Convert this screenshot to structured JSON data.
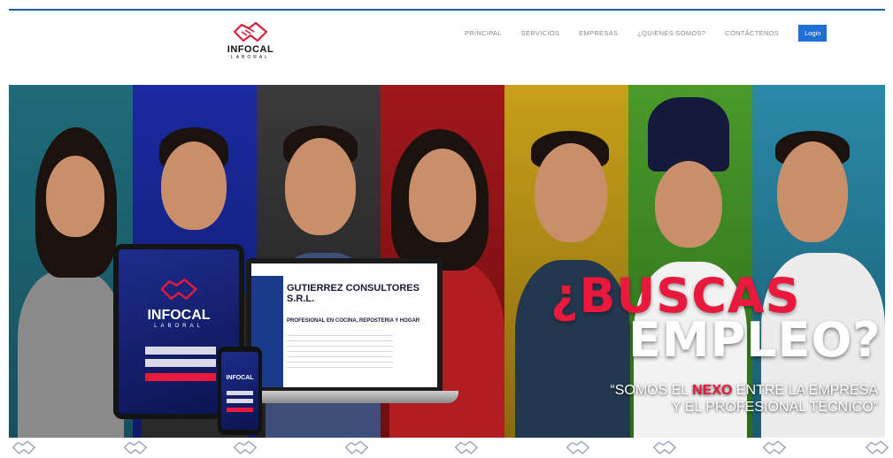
{
  "brand": {
    "name": "INFOCAL",
    "sub": "LABORAL"
  },
  "nav": {
    "items": [
      "PRINCIPAL",
      "SERVICIOS",
      "EMPRESAS",
      "¿QUIENES SOMOS?",
      "CONTÁCTENOS"
    ],
    "login": "Login"
  },
  "hero": {
    "headline1": "¿BUSCAS",
    "headline2": "EMPLEO?",
    "tagline_part1": "“SOMOS EL ",
    "tagline_highlight": "NEXO",
    "tagline_part2": " ENTRE LA EMPRESA",
    "tagline_line2": "Y EL PROFESIONAL TÉCNICO”",
    "tablet_brand": "INFOCAL",
    "tablet_sub": "LABORAL",
    "phone_brand": "INFOCAL",
    "laptop_company": "GUTIERREZ CONSULTORES S.R.L.",
    "laptop_job": "PROFESIONAL EN COCINA, REPOSTERIA Y HOGAR"
  },
  "colors": {
    "accent": "#e8193c",
    "login": "#1f6fd6",
    "topline": "#1f5fa8"
  },
  "icons": {
    "logo": "handshake-icon",
    "strip": "handshake-icon"
  }
}
